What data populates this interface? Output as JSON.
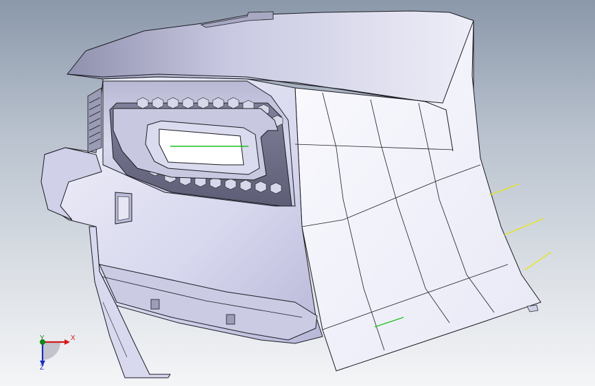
{
  "viewport": {
    "background_top": "#8b98aa",
    "background_bottom": "#f4f5f7"
  },
  "model": {
    "part": "rear-bumper",
    "shading": "shaded-with-edges",
    "face_color": "#d9d9ef",
    "edge_color": "#1a1a22",
    "sketch_lines_color": "#e7e41b",
    "selected_edge_color": "#18c118"
  },
  "triad": {
    "x_label": "X",
    "y_label": "Y",
    "z_label": "Z",
    "x_color": "#d01818",
    "y_color": "#0c8a14",
    "z_color": "#1a2fbd"
  }
}
